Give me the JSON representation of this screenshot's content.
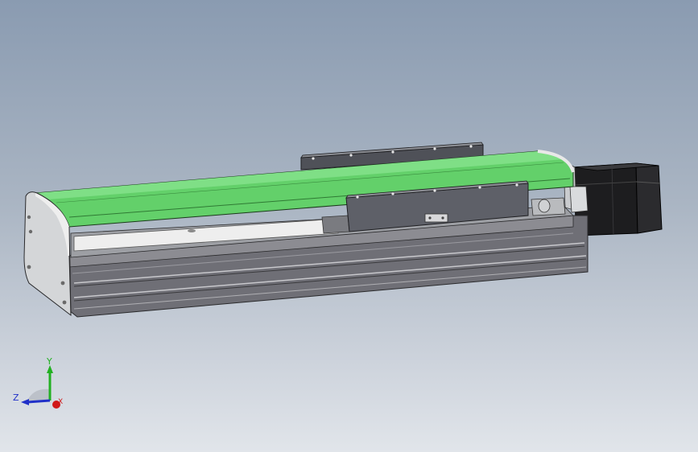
{
  "view": {
    "triad": {
      "x_label": "X",
      "y_label": "Y",
      "z_label": "Z",
      "x_color": "#d01818",
      "y_color": "#22b022",
      "z_color": "#2030c8"
    }
  },
  "model": {
    "cover_color": "#63d06a",
    "body_color": "#6f6f76",
    "endcap_color": "#d4d6d8",
    "motor_color": "#1c1c1c",
    "carriage_color": "#5e6068"
  }
}
